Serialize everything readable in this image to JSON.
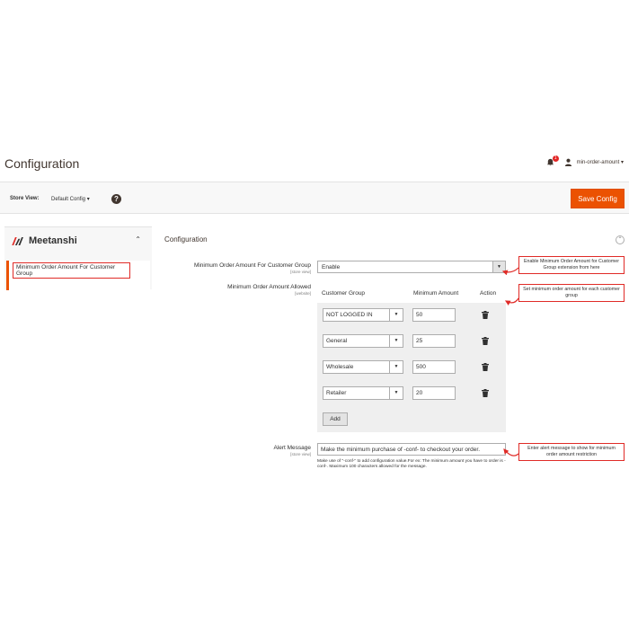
{
  "header": {
    "title": "Configuration",
    "notification_count": "1",
    "username": "min-order-amount ▾"
  },
  "storebar": {
    "label": "Store View:",
    "scope_value": "Default Config ▾",
    "help": "?",
    "save_label": "Save Config"
  },
  "sidebar": {
    "brand": "Meetanshi",
    "item": "Minimum Order Amount For Customer Group"
  },
  "section": {
    "title": "Configuration",
    "toggle": "⌃"
  },
  "fields": {
    "enable": {
      "label": "Minimum Order Amount For Customer Group",
      "scope": "[store view]",
      "value": "Enable"
    },
    "allowed": {
      "label": "Minimum Order Amount Allowed",
      "scope": "[website]",
      "headers": {
        "group": "Customer Group",
        "amount": "Minimum Amount",
        "action": "Action"
      },
      "rows": [
        {
          "group": "NOT LOGGED IN",
          "amount": "50"
        },
        {
          "group": "General",
          "amount": "25"
        },
        {
          "group": "Wholesale",
          "amount": "500"
        },
        {
          "group": "Retailer",
          "amount": "20"
        }
      ],
      "add_label": "Add"
    },
    "alert": {
      "label": "Alert Message",
      "scope": "[store view]",
      "value": "Make the minimum purchase of -conf- to checkout your order.",
      "note": "Make use of \"-conf-\" to add configuration value.For ex: The minimum amount you have to order is -conf-. Maximum 100 characters allowed for the message."
    }
  },
  "callouts": {
    "c1": "Enable Minimum Order Amount for Customer Group extension from here",
    "c2": "Set minimum order amount for each customer group",
    "c3": "Enter alert message to show for minimum order amount restriction"
  },
  "colors": {
    "accent": "#eb5202",
    "callout_border": "#e02b27"
  }
}
